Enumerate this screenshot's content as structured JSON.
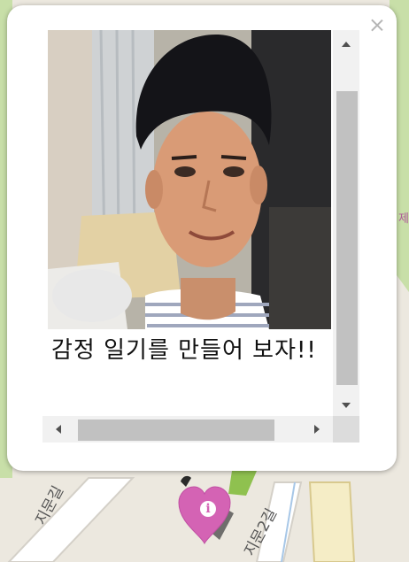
{
  "map": {
    "road_label_left": "지문길",
    "road_label_right": "지문2길",
    "edge_label_right": "제"
  },
  "info_window": {
    "diary_text": "감정 일기를 만들어 보자!!",
    "photo_alt": "selfie photo"
  },
  "marker": {
    "icon_glyph": "i",
    "color": "#d463b4"
  },
  "colors": {
    "background": "#ece8df",
    "road": "#ffffff",
    "green_area": "#c8dfa8",
    "scrollbar_track": "#f1f1f1",
    "scrollbar_thumb": "#c1c1c1"
  }
}
